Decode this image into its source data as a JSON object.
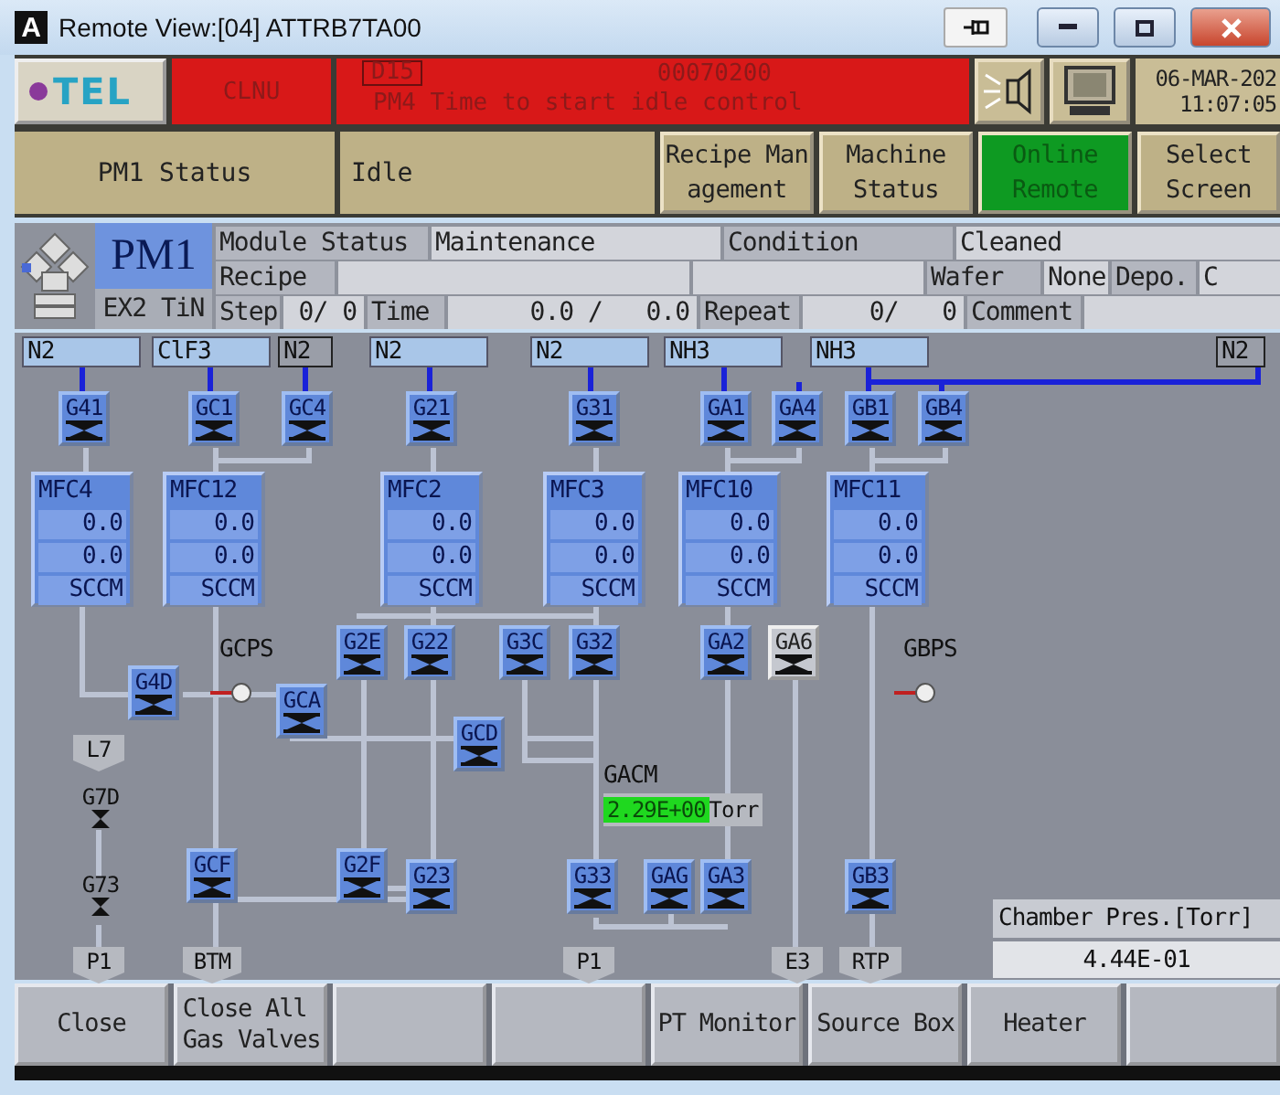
{
  "window": {
    "app_icon": "A",
    "title": "Remote View:[04] ATTRB7TA00"
  },
  "header": {
    "logo": "TEL",
    "alarm": "CLNU",
    "message_id": "D15",
    "message_code": "00070200",
    "message": "PM4 Time to start idle control",
    "date": "06-MAR-202",
    "time": "11:07:05"
  },
  "nav": [
    {
      "kind": "label",
      "lines": [
        "PM1 Status"
      ]
    },
    {
      "kind": "status",
      "lines": [
        "Idle"
      ]
    },
    {
      "kind": "button",
      "lines": [
        "Recipe Man",
        "agement"
      ],
      "selected": false
    },
    {
      "kind": "button",
      "lines": [
        "Machine",
        "Status"
      ],
      "selected": false
    },
    {
      "kind": "button",
      "lines": [
        "Online",
        "Remote"
      ],
      "selected": true
    },
    {
      "kind": "button",
      "lines": [
        "Select",
        "Screen"
      ],
      "selected": false
    }
  ],
  "module": {
    "name": "PM1",
    "subtitle": "EX2 TiN",
    "field_lines": [
      [
        {
          "kind": "label",
          "text": "Module Status"
        },
        {
          "kind": "value",
          "text": "Maintenance"
        },
        {
          "kind": "label",
          "text": "Condition"
        },
        {
          "kind": "value",
          "text": "Cleaned"
        }
      ],
      [
        {
          "kind": "label",
          "text": "Recipe"
        },
        {
          "kind": "value"
        },
        {
          "kind": "value"
        },
        {
          "kind": "label",
          "text": "Wafer"
        },
        {
          "kind": "value",
          "text": "None"
        },
        {
          "kind": "label",
          "text": "Depo."
        },
        {
          "kind": "value",
          "text": "C"
        }
      ],
      [
        {
          "kind": "label",
          "text": "Step"
        },
        {
          "kind": "value",
          "text": "0/ 0"
        },
        {
          "kind": "label",
          "text": "Time"
        },
        {
          "kind": "value",
          "text": "0.0 /   0.0"
        },
        {
          "kind": "label",
          "text": "Repeat"
        },
        {
          "kind": "value",
          "text": "0/   0"
        },
        {
          "kind": "label",
          "text": "Comment"
        },
        {
          "kind": "value"
        }
      ]
    ]
  },
  "diagram": {
    "gas_lines": [
      {
        "label": "N2",
        "active": true
      },
      {
        "label": "ClF3",
        "active": true
      },
      {
        "label": "N2",
        "active": false
      },
      {
        "label": "N2",
        "active": true
      },
      {
        "label": "N2",
        "active": true
      },
      {
        "label": "NH3",
        "active": true
      },
      {
        "label": "NH3",
        "active": true
      },
      {
        "label": "N2",
        "active": false
      }
    ],
    "valves": [
      {
        "label": "G41",
        "kind": "block",
        "open": true
      },
      {
        "label": "GC1",
        "kind": "block",
        "open": true
      },
      {
        "label": "GC4",
        "kind": "block",
        "open": true
      },
      {
        "label": "G21",
        "kind": "block",
        "open": true
      },
      {
        "label": "G31",
        "kind": "block",
        "open": true
      },
      {
        "label": "GA1",
        "kind": "block",
        "open": true
      },
      {
        "label": "GA4",
        "kind": "block",
        "open": true
      },
      {
        "label": "GB1",
        "kind": "block",
        "open": true
      },
      {
        "label": "GB4",
        "kind": "block",
        "open": true
      },
      {
        "label": "G2E",
        "kind": "block",
        "open": true
      },
      {
        "label": "G22",
        "kind": "block",
        "open": true
      },
      {
        "label": "G3C",
        "kind": "block",
        "open": true
      },
      {
        "label": "G32",
        "kind": "block",
        "open": true
      },
      {
        "label": "GA2",
        "kind": "block",
        "open": true
      },
      {
        "label": "GA6",
        "kind": "block",
        "open": false
      },
      {
        "label": "G4D",
        "kind": "block",
        "open": true
      },
      {
        "label": "GCA",
        "kind": "block",
        "open": true
      },
      {
        "label": "GCD",
        "kind": "block",
        "open": true
      },
      {
        "label": "G7D",
        "kind": "small",
        "open": true
      },
      {
        "label": "GCF",
        "kind": "block",
        "open": true
      },
      {
        "label": "G2F",
        "kind": "block",
        "open": true
      },
      {
        "label": "G23",
        "kind": "block",
        "open": true
      },
      {
        "label": "G33",
        "kind": "block",
        "open": true
      },
      {
        "label": "GAG",
        "kind": "block",
        "open": true
      },
      {
        "label": "GA3",
        "kind": "block",
        "open": true
      },
      {
        "label": "GB3",
        "kind": "block",
        "open": true
      },
      {
        "label": "G73",
        "kind": "small",
        "open": true
      }
    ],
    "mfcs": [
      {
        "label": "MFC4",
        "setpoint": "0.0",
        "actual": "0.0",
        "unit": "SCCM"
      },
      {
        "label": "MFC12",
        "setpoint": "0.0",
        "actual": "0.0",
        "unit": "SCCM"
      },
      {
        "label": "MFC2",
        "setpoint": "0.0",
        "actual": "0.0",
        "unit": "SCCM"
      },
      {
        "label": "MFC3",
        "setpoint": "0.0",
        "actual": "0.0",
        "unit": "SCCM"
      },
      {
        "label": "MFC10",
        "setpoint": "0.0",
        "actual": "0.0",
        "unit": "SCCM"
      },
      {
        "label": "MFC11",
        "setpoint": "0.0",
        "actual": "0.0",
        "unit": "SCCM"
      }
    ],
    "gauges": [
      {
        "label": "GCPS"
      },
      {
        "label": "GBPS"
      }
    ],
    "tags": [
      {
        "label": "L7"
      },
      {
        "label": "P1"
      },
      {
        "label": "BTM"
      },
      {
        "label": "P1"
      },
      {
        "label": "E3"
      },
      {
        "label": "RTP"
      }
    ],
    "gacm": {
      "label": "GACM",
      "value": "2.29E+00",
      "unit": "Torr"
    },
    "chamber": {
      "label": "Chamber Pres.[Torr]",
      "value": "4.44E-01"
    }
  },
  "buttons": [
    {
      "kind": "button",
      "lines": [
        "Close"
      ]
    },
    {
      "kind": "button",
      "lines": [
        "Close All",
        "Gas Valves"
      ]
    },
    {
      "kind": "blank"
    },
    {
      "kind": "blank"
    },
    {
      "kind": "button",
      "lines": [
        "PT Monitor"
      ]
    },
    {
      "kind": "button",
      "lines": [
        "Source Box"
      ]
    },
    {
      "kind": "button",
      "lines": [
        "Heater"
      ]
    },
    {
      "kind": "blank"
    }
  ]
}
